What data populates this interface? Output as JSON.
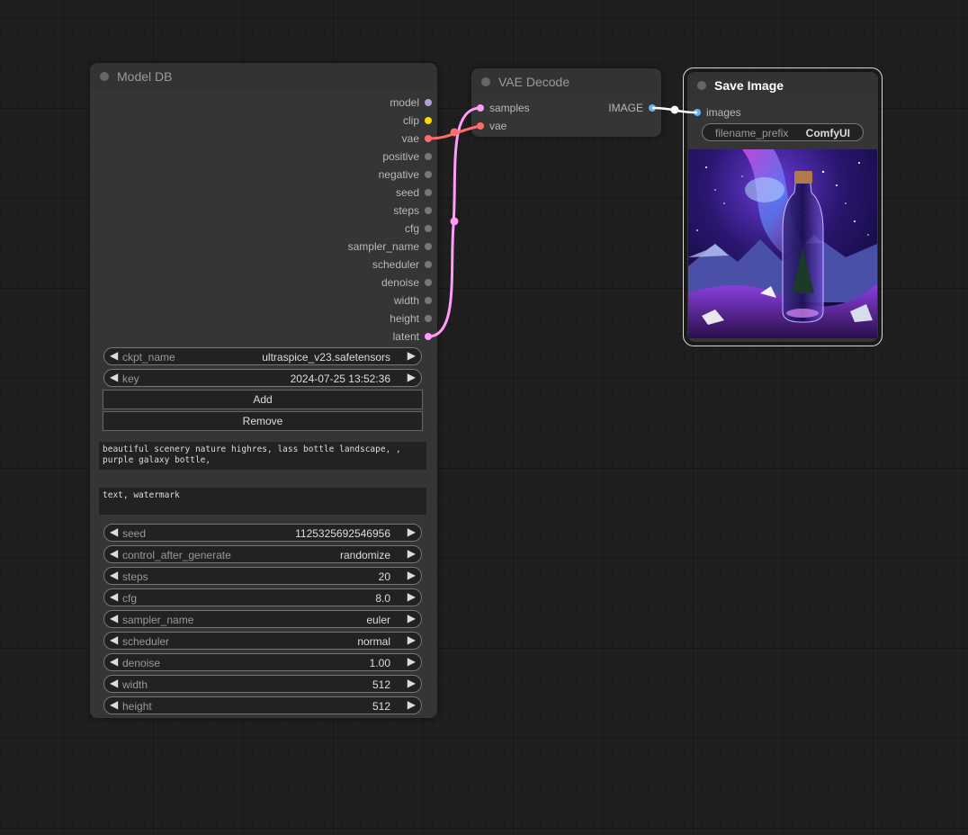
{
  "model_db": {
    "title": "Model DB",
    "outputs": [
      {
        "label": "model",
        "color": "#b39ddb"
      },
      {
        "label": "clip",
        "color": "#ffd500"
      },
      {
        "label": "vae",
        "color": "#ff6e6e"
      },
      {
        "label": "positive",
        "color": "#777777"
      },
      {
        "label": "negative",
        "color": "#777777"
      },
      {
        "label": "seed",
        "color": "#777777"
      },
      {
        "label": "steps",
        "color": "#777777"
      },
      {
        "label": "cfg",
        "color": "#777777"
      },
      {
        "label": "sampler_name",
        "color": "#777777"
      },
      {
        "label": "scheduler",
        "color": "#777777"
      },
      {
        "label": "denoise",
        "color": "#777777"
      },
      {
        "label": "width",
        "color": "#777777"
      },
      {
        "label": "height",
        "color": "#777777"
      },
      {
        "label": "latent",
        "color": "#ff9cf9"
      }
    ],
    "widgets_top": [
      {
        "name": "ckpt_name",
        "value": "ultraspice_v23.safetensors"
      },
      {
        "name": "key",
        "value": "2024-07-25 13:52:36"
      }
    ],
    "add_label": "Add",
    "remove_label": "Remove",
    "positive_text": "beautiful scenery nature highres, lass bottle landscape, , purple galaxy bottle,",
    "negative_text": "text, watermark",
    "widgets_bottom": [
      {
        "name": "seed",
        "value": "1125325692546956"
      },
      {
        "name": "control_after_generate",
        "value": "randomize"
      },
      {
        "name": "steps",
        "value": "20"
      },
      {
        "name": "cfg",
        "value": "8.0"
      },
      {
        "name": "sampler_name",
        "value": "euler"
      },
      {
        "name": "scheduler",
        "value": "normal"
      },
      {
        "name": "denoise",
        "value": "1.00"
      },
      {
        "name": "width",
        "value": "512"
      },
      {
        "name": "height",
        "value": "512"
      }
    ]
  },
  "vae_decode": {
    "title": "VAE Decode",
    "inputs": [
      {
        "label": "samples",
        "color": "#ff9cf9"
      },
      {
        "label": "vae",
        "color": "#ff6e6e"
      }
    ],
    "output": {
      "label": "IMAGE",
      "color": "#64b5f6"
    }
  },
  "save_image": {
    "title": "Save Image",
    "input": {
      "label": "images",
      "color": "#64b5f6"
    },
    "filename_prefix": {
      "name": "filename_prefix",
      "value": "ComfyUI"
    }
  },
  "colors": {
    "latent_link": "#ff9cf9",
    "vae_link": "#ff6e6e",
    "image_link": "#ffffff"
  }
}
